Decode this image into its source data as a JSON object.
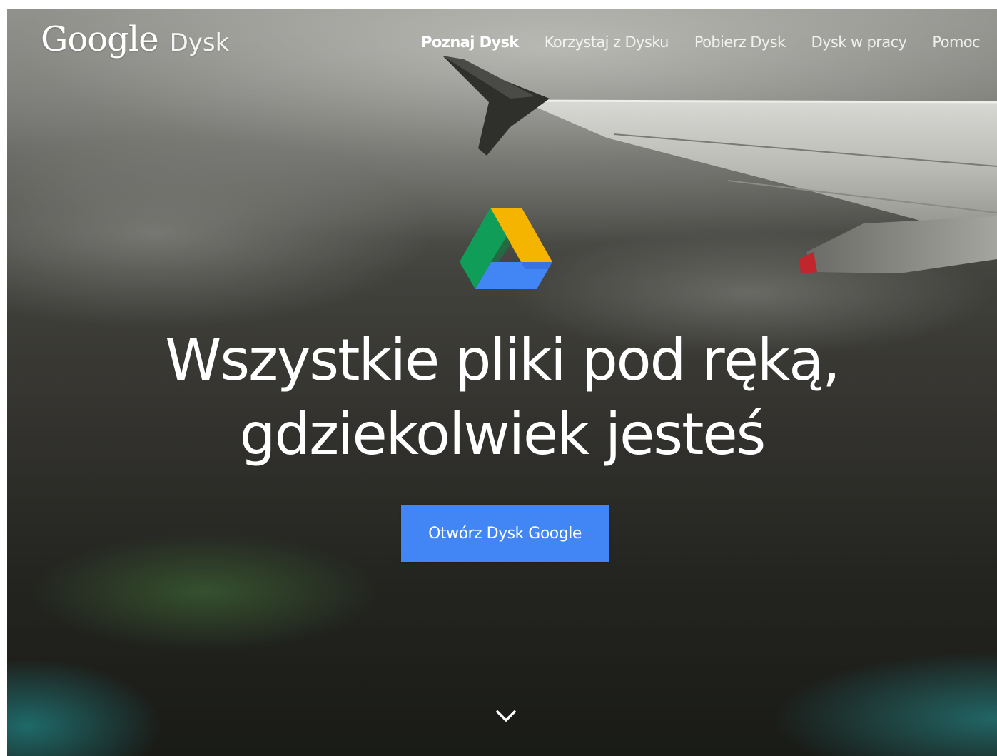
{
  "header": {
    "brand_google": "Google",
    "brand_product": "Dysk",
    "nav": [
      {
        "label": "Poznaj Dysk",
        "active": true
      },
      {
        "label": "Korzystaj z Dysku",
        "active": false
      },
      {
        "label": "Pobierz Dysk",
        "active": false
      },
      {
        "label": "Dysk w pracy",
        "active": false
      },
      {
        "label": "Pomoc",
        "active": false
      }
    ]
  },
  "hero": {
    "logo_icon": "google-drive-logo",
    "headline_line1": "Wszystkie pliki pod ręką,",
    "headline_line2": "gdziekolwiek jesteś",
    "cta_label": "Otwórz Dysk Google",
    "scroll_icon": "chevron-down-icon"
  },
  "colors": {
    "cta_blue": "#4285f4",
    "drive_green": "#0f9d58",
    "drive_yellow": "#f4b400",
    "drive_blue": "#4285f4"
  }
}
